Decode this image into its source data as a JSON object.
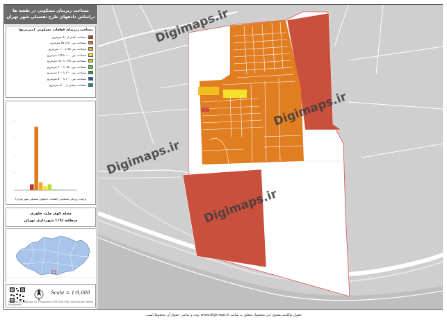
{
  "sidebar": {
    "title_line1": "مساحت زیربنای مسکونی در نقشه ها",
    "title_line2": "دراساس دادههای طرح تفصیلی شهر تهران"
  },
  "legend": {
    "title": "مساحت زیربنای قطعات مسکونی (مترمربع)",
    "items": [
      {
        "label": "مساحت کمتر از ۵۰ مترمربع",
        "color": "#c0392b"
      },
      {
        "label": "مساحت بین ۵۰ تا ۷۵ مترمربع",
        "color": "#e07b20"
      },
      {
        "label": "مساحت بین ۷۵ تا ۱۰۰ مترمربع",
        "color": "#f0a830"
      },
      {
        "label": "مساحت بین ۱۰۰ تا ۱۲۵ مترمربع",
        "color": "#f5e02a"
      },
      {
        "label": "مساحت بین ۱۲۵ تا ۱۵۰ مترمربع",
        "color": "#b5e030"
      },
      {
        "label": "مساحت بین ۱۵۰ تا ۲۰۰ مترمربع",
        "color": "#5fd030"
      },
      {
        "label": "مساحت بین ۲۰۰ تا ۳۰۰ مترمربع",
        "color": "#28a040"
      },
      {
        "label": "مساحت بین ۳۰۰ تا ۵۰۰ مترمربع",
        "color": "#1f5fa0"
      },
      {
        "label": "مساحت بیشتر از ۵۰۰ مترمربع",
        "color": "#1a8fa8"
      }
    ]
  },
  "chart_data": {
    "type": "bar",
    "values": [
      3,
      32,
      4,
      2,
      3,
      0.3,
      0.2,
      0.1,
      0.1
    ],
    "colors": [
      "#c0392b",
      "#e07b20",
      "#f0a830",
      "#f5e02a",
      "#b5e030",
      "#5fd030",
      "#28a040",
      "#1f5fa0",
      "#1a8fa8"
    ],
    "ylim": [
      0,
      35
    ],
    "caption": "ترکیب زیربنای مسکونی (طبقات دادههای تفصیلی شهر تهران)"
  },
  "district": {
    "line1": "محله کوی ملت خاوری",
    "line2": "منطقه (۱۹) شهرداری تهران"
  },
  "scale_text": "Scale = 1:9,000",
  "credit": "Prepared by: Digimaps Co. | Projection: UTM Zone 39N | Data Source: Tehran Municipality",
  "watermark": "Digimaps.ir",
  "footer": "حقوق مالکیت معنوی این محصول متعلق به سایت www.digimaps.ir بوده و تمامی حقوق آن محفوظ است."
}
